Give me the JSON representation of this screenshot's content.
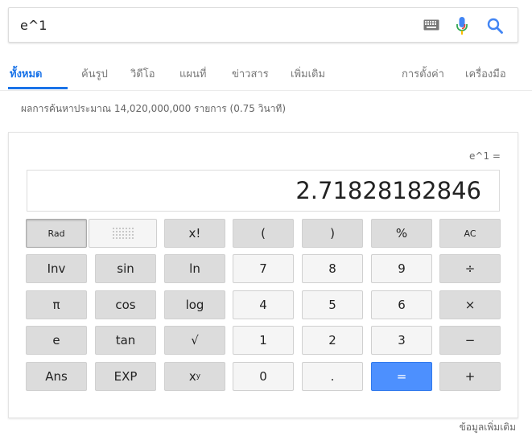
{
  "search": {
    "query": "e^1"
  },
  "tabs": [
    {
      "label": "ทั้งหมด"
    },
    {
      "label": "ค้นรูป"
    },
    {
      "label": "วิดีโอ"
    },
    {
      "label": "แผนที่"
    },
    {
      "label": "ข่าวสาร"
    },
    {
      "label": "เพิ่มเติม"
    },
    {
      "label": "การตั้งค่า"
    },
    {
      "label": "เครื่องมือ"
    }
  ],
  "active_tab": "ทั้งหมด",
  "results_stats": "ผลการค้นหาประมาณ 14,020,000,000 รายการ (0.75 วินาที)",
  "calculator": {
    "expression": "e^1 =",
    "result": "2.71828182846",
    "keys": {
      "rad": "Rad",
      "fact": "x!",
      "lparen": "(",
      "rparen": ")",
      "percent": "%",
      "ac": "AC",
      "inv": "Inv",
      "sin": "sin",
      "ln": "ln",
      "k7": "7",
      "k8": "8",
      "k9": "9",
      "div": "÷",
      "pi": "π",
      "cos": "cos",
      "log": "log",
      "k4": "4",
      "k5": "5",
      "k6": "6",
      "mul": "×",
      "e": "e",
      "tan": "tan",
      "sqrt": "√",
      "k1": "1",
      "k2": "2",
      "k3": "3",
      "minus": "−",
      "ans": "Ans",
      "exp": "EXP",
      "k0": "0",
      "dot": ".",
      "equals": "=",
      "plus": "+"
    }
  },
  "footer": {
    "more_info": "ข้อมูลเพิ่มเติม"
  },
  "colors": {
    "accent": "#1a73e8",
    "equals_button": "#4d90fe",
    "function_key": "#dcdcdc",
    "number_key": "#f5f5f5"
  },
  "icons": [
    "keyboard-icon",
    "microphone-icon",
    "search-icon"
  ]
}
